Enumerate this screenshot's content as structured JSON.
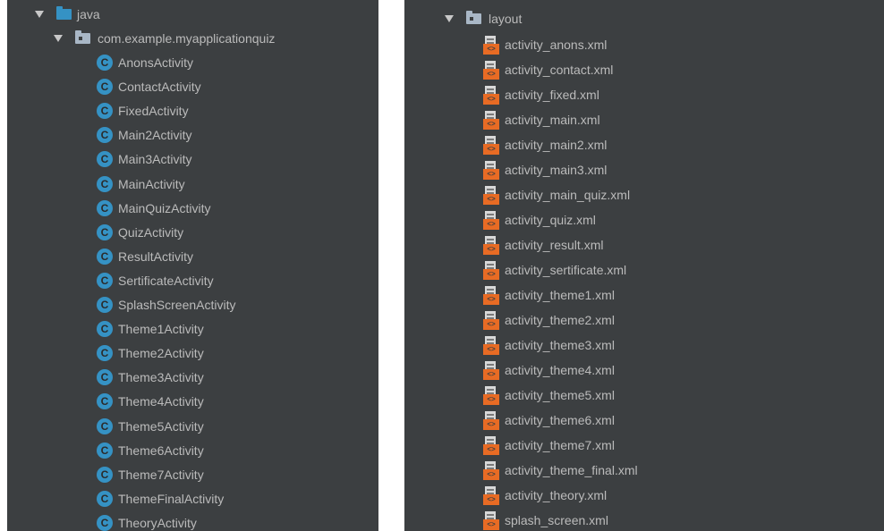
{
  "project_tree": {
    "java_folder": {
      "label": "java",
      "package": {
        "label": "com.example.myapplicationquiz",
        "classes": [
          "AnonsActivity",
          "ContactActivity",
          "FixedActivity",
          "Main2Activity",
          "Main3Activity",
          "MainActivity",
          "MainQuizActivity",
          "QuizActivity",
          "ResultActivity",
          "SertificateActivity",
          "SplashScreenActivity",
          "Theme1Activity",
          "Theme2Activity",
          "Theme3Activity",
          "Theme4Activity",
          "Theme5Activity",
          "Theme6Activity",
          "Theme7Activity",
          "ThemeFinalActivity",
          "TheoryActivity"
        ]
      }
    },
    "layout_folder": {
      "label": "layout",
      "files": [
        "activity_anons.xml",
        "activity_contact.xml",
        "activity_fixed.xml",
        "activity_main.xml",
        "activity_main2.xml",
        "activity_main3.xml",
        "activity_main_quiz.xml",
        "activity_quiz.xml",
        "activity_result.xml",
        "activity_sertificate.xml",
        "activity_theme1.xml",
        "activity_theme2.xml",
        "activity_theme3.xml",
        "activity_theme4.xml",
        "activity_theme5.xml",
        "activity_theme6.xml",
        "activity_theme7.xml",
        "activity_theme_final.xml",
        "activity_theory.xml",
        "splash_screen.xml"
      ]
    }
  },
  "icons": {
    "class_icon_letter": "C",
    "xml_icon_text": "<>",
    "folder_icon": "folder-icon",
    "package_icon": "package-icon",
    "expand_icon": "chevron-down-icon"
  },
  "colors": {
    "panel_bg": "#3c3f41",
    "text": "#bbbbbb",
    "folder_blue": "#3592c4",
    "class_icon_blue": "#3592c4",
    "xml_icon_orange": "#e86b24"
  }
}
